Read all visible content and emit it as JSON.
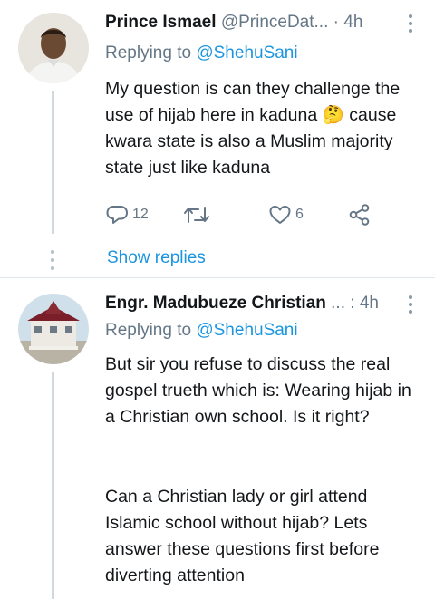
{
  "tweets": [
    {
      "name": "Prince Ismael",
      "handle": "@PrinceDat...",
      "time": "· 4h",
      "replying_prefix": "Replying to",
      "replying_to": "@ShehuSani",
      "text": "My question is can they challenge the use of hijab here in kaduna 🤔 cause kwara state is also a Muslim majority state just like kaduna",
      "reply_count": "12",
      "retweet_count": "",
      "like_count": "6",
      "show_replies": "Show replies"
    },
    {
      "name": "Engr. Madubueze Christian",
      "handle": "...",
      "time": ": 4h",
      "replying_prefix": "Replying to",
      "replying_to": "@ShehuSani",
      "text_p1": "But sir you refuse to discuss the real gospel trueth which is: Wearing hijab in a Christian own school. Is it right?",
      "text_p2": "Can a Christian lady or girl attend Islamic school without hijab? Lets answer these questions first before diverting attention"
    }
  ],
  "colors": {
    "accent": "#1b95e0",
    "muted": "#657786",
    "text": "#14171a"
  },
  "icons": [
    "reply-icon",
    "retweet-icon",
    "like-icon",
    "share-icon",
    "more-icon"
  ]
}
